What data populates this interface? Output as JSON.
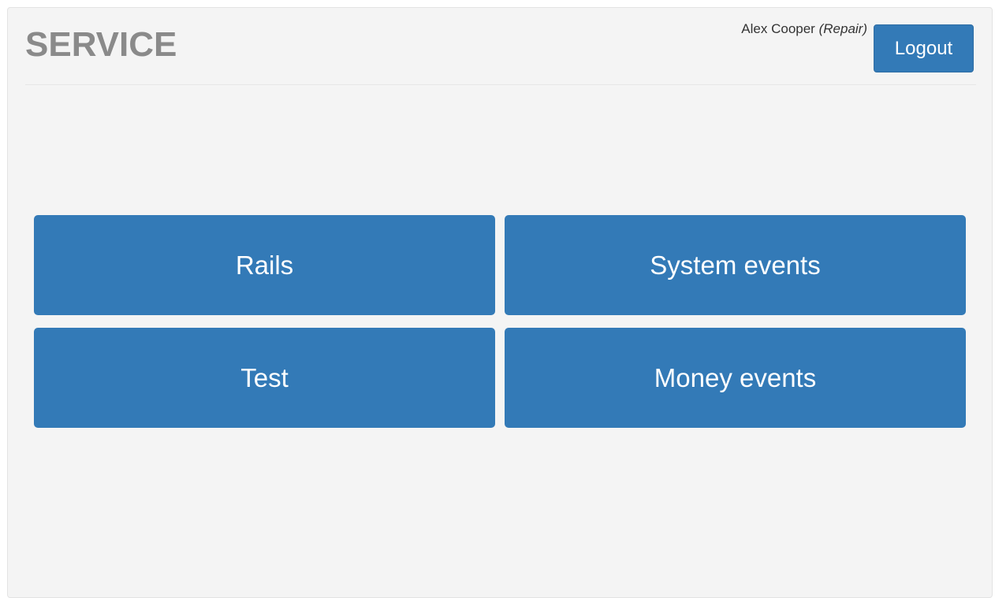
{
  "header": {
    "title": "SERVICE",
    "user_name": "Alex Cooper",
    "user_role": "(Repair)",
    "logout_label": "Logout"
  },
  "tiles": [
    {
      "label": "Rails"
    },
    {
      "label": "System events"
    },
    {
      "label": "Test"
    },
    {
      "label": "Money events"
    }
  ],
  "colors": {
    "primary": "#337ab7",
    "panel_background": "#f4f4f4",
    "title": "#8a8a8a"
  }
}
